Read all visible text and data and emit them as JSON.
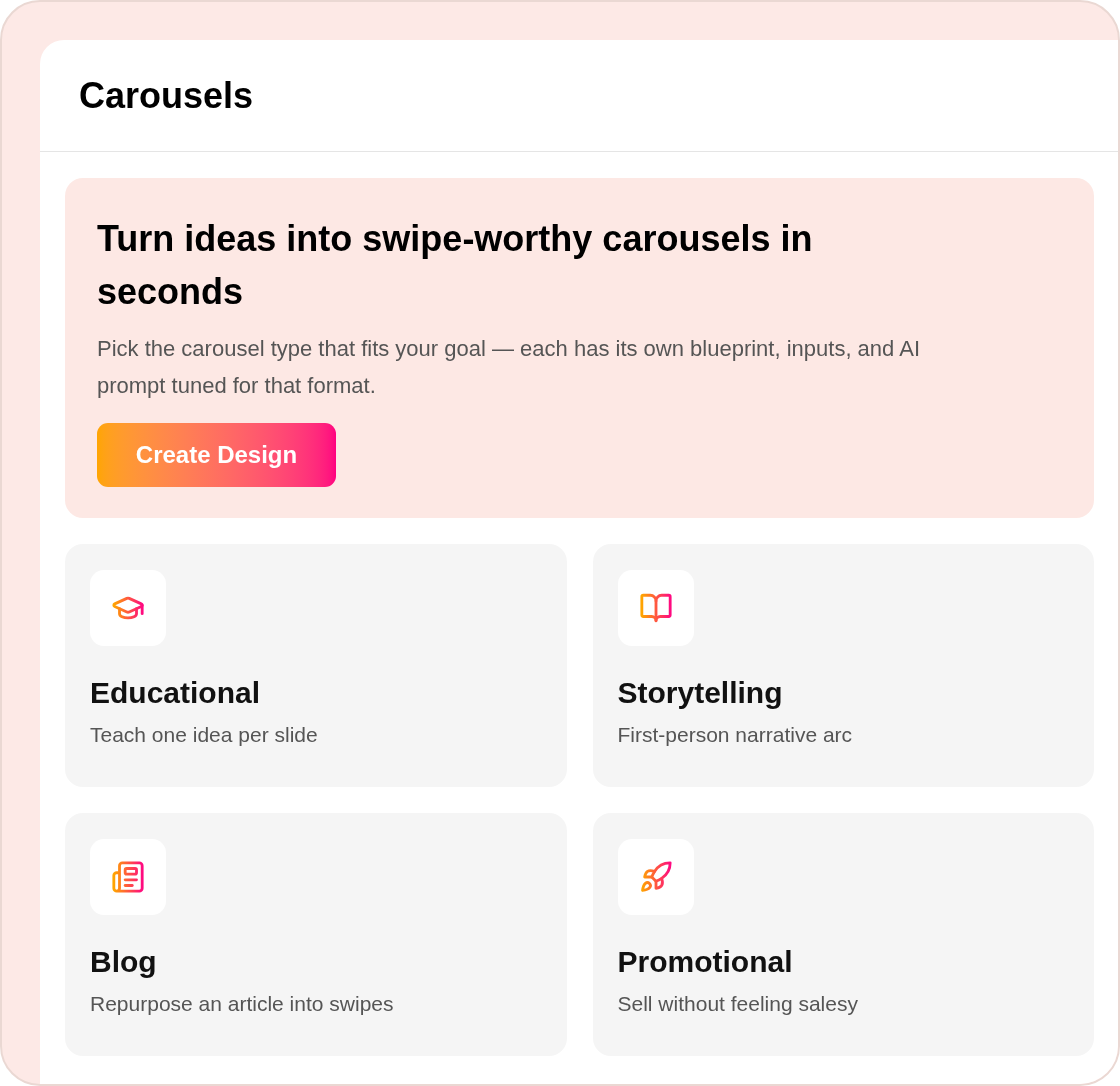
{
  "page": {
    "title": "Carousels"
  },
  "hero": {
    "title": "Turn ideas into swipe-worthy carousels in seconds",
    "description": "Pick the carousel type that fits your goal — each has its own blueprint, inputs, and AI prompt tuned for that format.",
    "button": "Create Design"
  },
  "carousel_types": [
    {
      "title": "Educational",
      "description": "Teach one idea per slide"
    },
    {
      "title": "Storytelling",
      "description": "First-person narrative arc"
    },
    {
      "title": "Blog",
      "description": "Repurpose an article into swipes"
    },
    {
      "title": "Promotional",
      "description": "Sell without feeling salesy"
    }
  ]
}
